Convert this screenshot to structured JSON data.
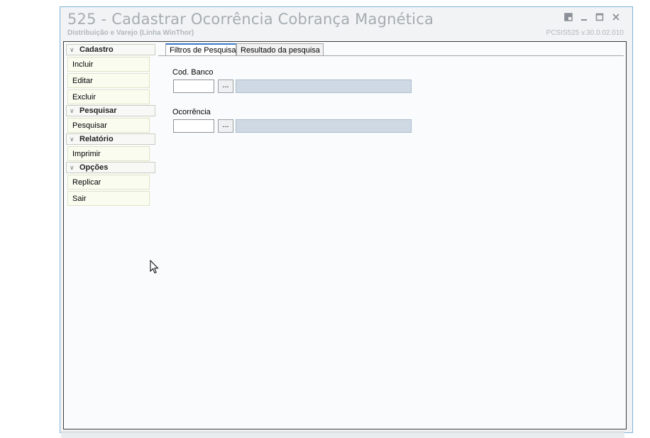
{
  "window": {
    "title": "525 - Cadastrar Ocorrência Cobrança Magnética",
    "subtitle": "Distribuição e Varejo (Linha WinThor)",
    "version": "PCSIS525  v.30.0.02.010",
    "controls": [
      "restore-icon",
      "minimize-icon",
      "maximize-icon",
      "close-icon"
    ]
  },
  "sidebar": {
    "groups": [
      {
        "header": "Cadastro",
        "items": [
          "Incluir",
          "Editar",
          "Excluir"
        ]
      },
      {
        "header": "Pesquisar",
        "items": [
          "Pesquisar"
        ]
      },
      {
        "header": "Relatório",
        "items": [
          "Imprimir"
        ]
      },
      {
        "header": "Opções",
        "items": [
          "Replicar",
          "Sair"
        ]
      }
    ]
  },
  "tabs": [
    {
      "label": "Filtros de Pesquisa",
      "active": true
    },
    {
      "label": "Resultado da pesquisa",
      "active": false
    }
  ],
  "filters": {
    "cod_banco": {
      "label": "Cod. Banco",
      "value": "",
      "lookup_label": "..."
    },
    "ocorrencia": {
      "label": "Ocorrência",
      "value": "",
      "lookup_label": "..."
    }
  },
  "colors": {
    "window_border": "#7fb3d9",
    "sidebar_button_bg": "#fbfcf0",
    "description_field_bg": "#cfd9e3",
    "active_tab_accent": "#3a79c6"
  }
}
